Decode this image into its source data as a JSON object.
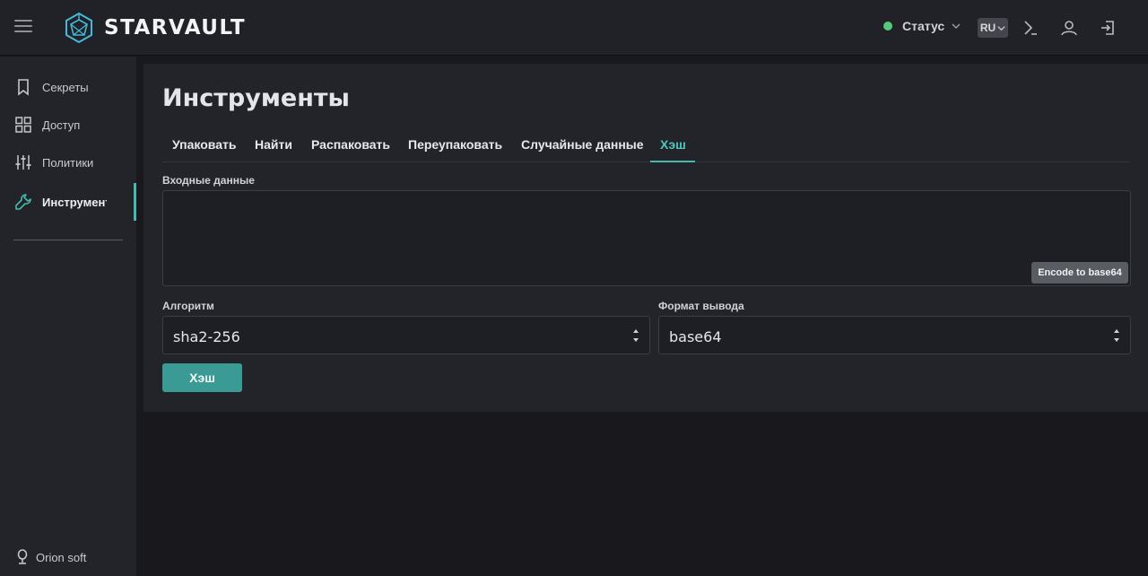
{
  "header": {
    "brand": "STARVAULT",
    "status_label": "Статус",
    "status_color": "#57c97a",
    "language": "RU",
    "icons": [
      "menu-icon",
      "console-icon",
      "user-icon",
      "logout-icon"
    ]
  },
  "sidebar": {
    "items": [
      {
        "label": "Секреты",
        "icon": "bookmark-icon"
      },
      {
        "label": "Доступ",
        "icon": "grid-icon"
      },
      {
        "label": "Политики",
        "icon": "sliders-icon"
      },
      {
        "label": "Инструменты",
        "icon": "wrench-icon",
        "active": true
      }
    ],
    "footer": "Orion soft"
  },
  "main": {
    "title": "Инструменты",
    "tabs": [
      {
        "label": "Упаковать"
      },
      {
        "label": "Найти"
      },
      {
        "label": "Распаковать"
      },
      {
        "label": "Переупаковать"
      },
      {
        "label": "Случайные данные"
      },
      {
        "label": "Хэш",
        "active": true
      }
    ],
    "input": {
      "label": "Входные данные",
      "value": ""
    },
    "encode_button": "Encode to base64",
    "algorithm": {
      "label": "Алгоритм",
      "value": "sha2-256"
    },
    "output_format": {
      "label": "Формат вывода",
      "value": "base64"
    },
    "submit_button": "Хэш"
  },
  "colors": {
    "accent": "#46b8b0",
    "button": "#3a9b95"
  }
}
